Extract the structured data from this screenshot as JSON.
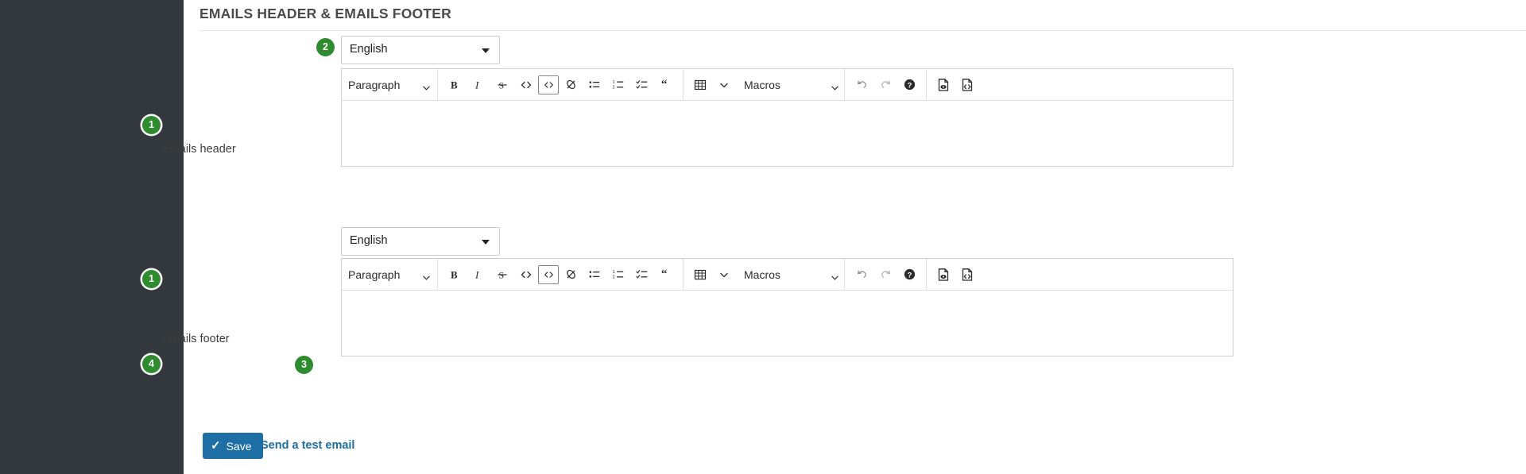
{
  "page": {
    "title": "EMAILS HEADER & EMAILS FOOTER"
  },
  "colors": {
    "sidebar": "#33383c",
    "badge_green": "#2e8b2e",
    "primary_blue": "#1d6fa5",
    "link_blue": "#1c6ea4",
    "border_grey": "#cfcfcf"
  },
  "badges": {
    "step1_header": "1",
    "step1_footer": "1",
    "step2": "2",
    "step3": "3",
    "step4": "4"
  },
  "header_section": {
    "label": "Emails header",
    "language": {
      "value": "English",
      "options": [
        "English"
      ]
    },
    "editor": {
      "block_format": "Paragraph",
      "macros": "Macros",
      "body_text": "",
      "body_placeholder": ""
    }
  },
  "footer_section": {
    "label": "Emails footer",
    "language": {
      "value": "English",
      "options": [
        "English"
      ]
    },
    "editor": {
      "block_format": "Paragraph",
      "macros": "Macros",
      "body_text": "",
      "body_placeholder": ""
    }
  },
  "toolbar_icons": [
    {
      "name": "bold-icon",
      "title": "Bold"
    },
    {
      "name": "italic-icon",
      "title": "Italic"
    },
    {
      "name": "strikethrough-icon",
      "title": "Strikethrough"
    },
    {
      "name": "inline-code-icon",
      "title": "Inline code"
    },
    {
      "name": "code-block-icon",
      "title": "Code block"
    },
    {
      "name": "link-icon",
      "title": "Link"
    },
    {
      "name": "bullet-list-icon",
      "title": "Bulleted list"
    },
    {
      "name": "numbered-list-icon",
      "title": "Numbered list"
    },
    {
      "name": "checklist-icon",
      "title": "Checklist"
    },
    {
      "name": "blockquote-icon",
      "title": "Blockquote"
    },
    {
      "name": "table-icon",
      "title": "Table"
    },
    {
      "name": "undo-icon",
      "title": "Undo"
    },
    {
      "name": "redo-icon",
      "title": "Redo"
    },
    {
      "name": "help-icon",
      "title": "Help"
    },
    {
      "name": "preview-document-icon",
      "title": "Preview"
    },
    {
      "name": "source-code-document-icon",
      "title": "Source code"
    }
  ],
  "actions": {
    "save_label": "Save",
    "send_test_email_label": "Send a test email"
  }
}
